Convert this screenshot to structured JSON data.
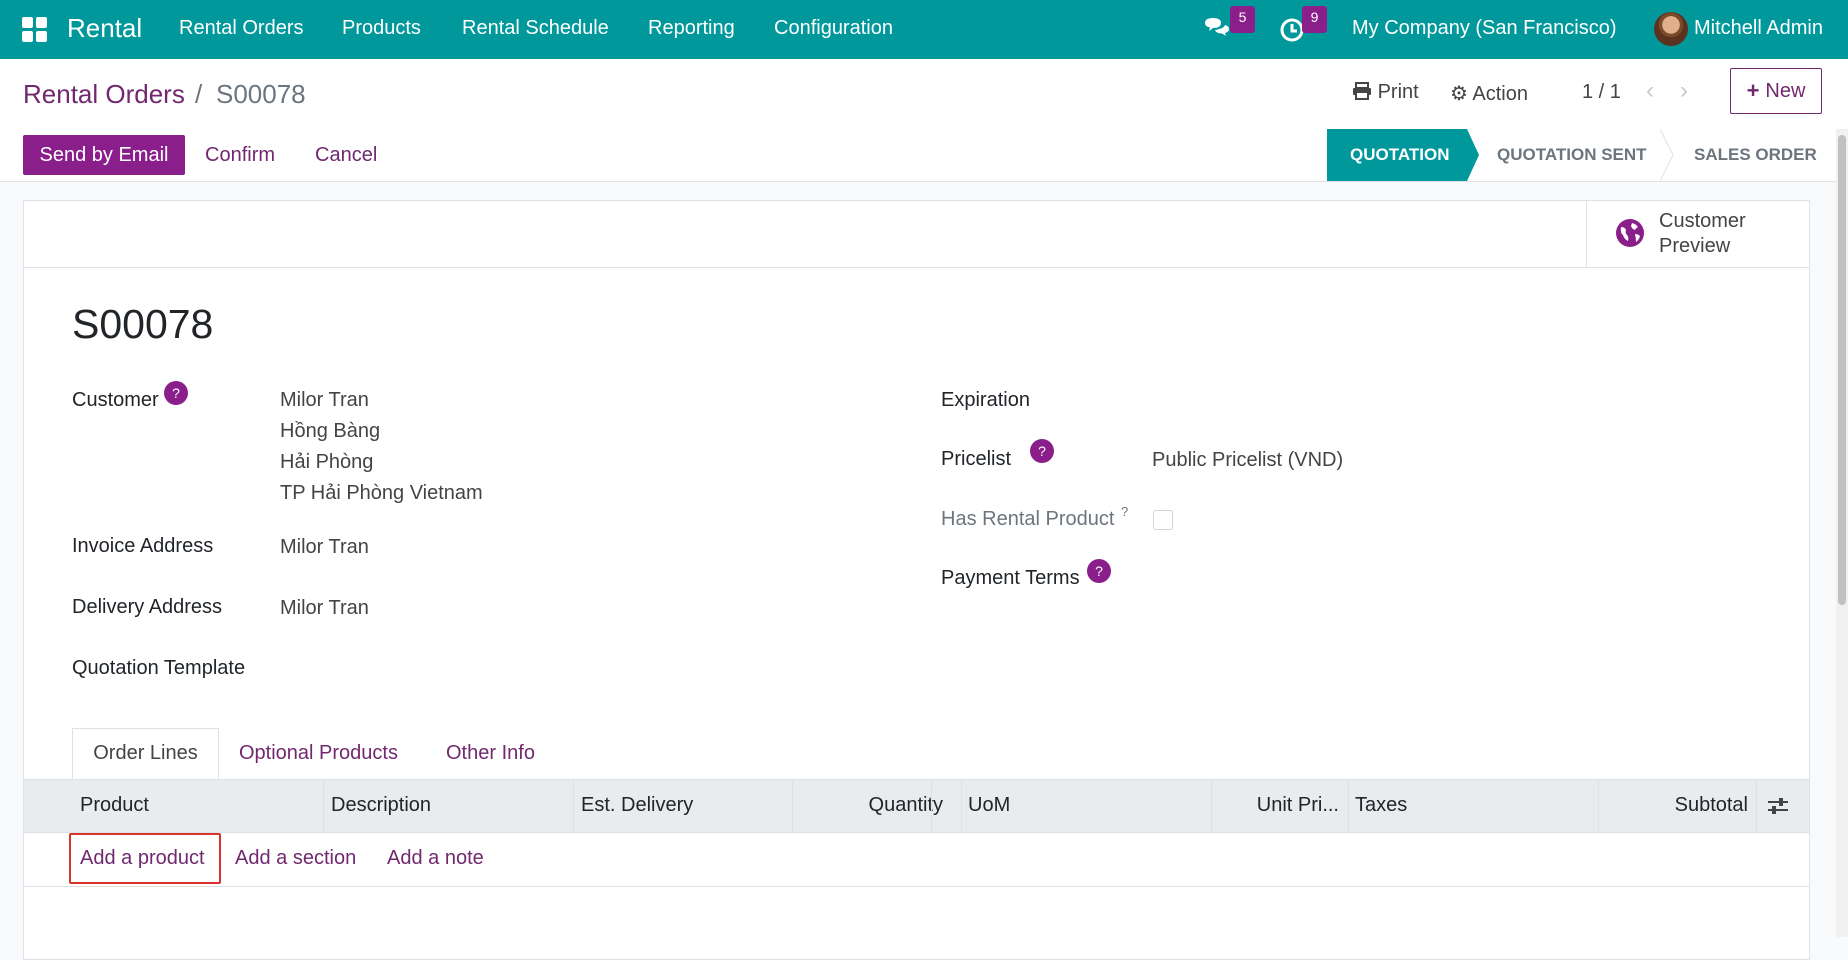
{
  "topbar": {
    "app_name": "Rental",
    "menu": [
      "Rental Orders",
      "Products",
      "Rental Schedule",
      "Reporting",
      "Configuration"
    ],
    "messages_count": "5",
    "activities_count": "9",
    "company": "My Company (San Francisco)",
    "user": "Mitchell Admin"
  },
  "control": {
    "breadcrumb_parent": "Rental Orders",
    "breadcrumb_sep": "/",
    "breadcrumb_current": "S00078",
    "print_label": "Print",
    "action_label": "Action",
    "pager": "1 / 1",
    "new_label": "New"
  },
  "statusbar": {
    "send_email": "Send by Email",
    "confirm": "Confirm",
    "cancel": "Cancel",
    "stages": [
      "QUOTATION",
      "QUOTATION SENT",
      "SALES ORDER"
    ],
    "active_stage": "QUOTATION"
  },
  "sheet": {
    "customer_preview": "Customer Preview",
    "record_name": "S00078",
    "labels": {
      "customer": "Customer",
      "invoice_address": "Invoice Address",
      "delivery_address": "Delivery Address",
      "quotation_template": "Quotation Template",
      "expiration": "Expiration",
      "pricelist": "Pricelist",
      "has_rental_product": "Has Rental Product",
      "payment_terms": "Payment Terms"
    },
    "values": {
      "customer_lines": [
        "Milor Tran",
        "Hồng Bàng",
        "Hải Phòng",
        "TP Hải Phòng Vietnam"
      ],
      "invoice_address": "Milor Tran",
      "delivery_address": "Milor Tran",
      "pricelist": "Public Pricelist (VND)",
      "has_rental_product": false
    },
    "help_mark": "?",
    "tabs": [
      "Order Lines",
      "Optional Products",
      "Other Info"
    ],
    "active_tab": "Order Lines",
    "columns": [
      "Product",
      "Description",
      "Est. Delivery",
      "Quantity",
      "UoM",
      "Unit Pri...",
      "Taxes",
      "Subtotal"
    ],
    "add_links": [
      "Add a product",
      "Add a section",
      "Add a note"
    ]
  },
  "colors": {
    "nav": "#00989b",
    "primary": "#8a1f8b",
    "link": "#71286f",
    "highlight": "#d9342b"
  }
}
